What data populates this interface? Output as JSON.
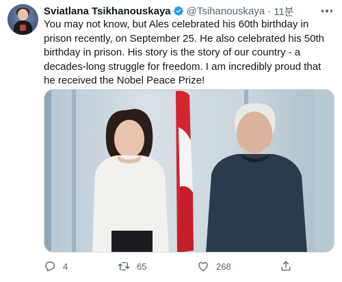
{
  "tweet": {
    "author": {
      "display_name": "Sviatlana Tsikhanouskaya",
      "handle": "@Tsihanouskaya",
      "verified": true,
      "avatar_icon": "profile-photo"
    },
    "separator": "·",
    "timestamp": "11분",
    "text": "You may not know, but Ales celebrated his 60th birthday in prison recently, on September 25. He also celebrated his 50th birthday in prison. His story is the story of our country - a decades-long struggle for freedom. I am incredibly proud that he received the Nobel Peace Prize!",
    "media": {
      "type": "photo",
      "description_icon": "photo-two-people-with-flag"
    },
    "actions": {
      "reply_count": "4",
      "retweet_count": "65",
      "like_count": "268"
    }
  },
  "colors": {
    "text_primary": "#0f1419",
    "text_secondary": "#536471",
    "verified_blue": "#1d9bf0",
    "flag_red": "#d22730"
  }
}
